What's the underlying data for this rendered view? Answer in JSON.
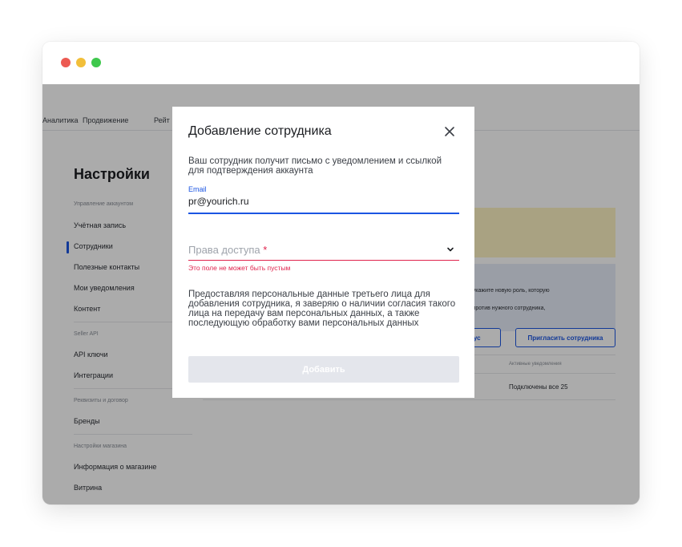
{
  "window": {
    "controls": [
      "close",
      "minimize",
      "maximize"
    ]
  },
  "topnav": {
    "items": [
      "Аналитика",
      "Продвижение",
      "Рейт"
    ]
  },
  "sidebar": {
    "title": "Настройки",
    "groups": [
      {
        "label": "Управление аккаунтом",
        "items": [
          "Учётная запись",
          "Сотрудники",
          "Полезные контакты",
          "Мои уведомления",
          "Контент"
        ]
      },
      {
        "label": "Seller API",
        "items": [
          "API ключи",
          "Интеграции"
        ]
      },
      {
        "label": "Реквизиты и договор",
        "items": [
          "Бренды"
        ]
      },
      {
        "label": "Настройки магазина",
        "items": [
          "Информация о магазине",
          "Витрина"
        ]
      }
    ],
    "active_item": "Сотрудники"
  },
  "main": {
    "info_line_1": "тем укажите новую роль, которую",
    "info_line_2": "е напротив нужного сотрудника,",
    "status_button": "татус",
    "invite_button": "Пригласить сотрудника",
    "table": {
      "column_header": "Активные уведомления",
      "cell": "Подключены все 25"
    }
  },
  "modal": {
    "title": "Добавление сотрудника",
    "description": "Ваш сотрудник получит письмо с уведомлением и ссылкой для подтверждения аккаунта",
    "email_label": "Email",
    "email_value": "pr@yourich.ru",
    "access_placeholder": "Права доступа",
    "required_mark": "*",
    "error": "Это поле не может быть пустым",
    "consent": "Предоставляя персональные данные третьего лица для добавления сотрудника, я заверяю о наличии согласия такого лица на передачу вам персональных данных, а также последующую обработку вами персональных данных",
    "submit": "Добавить"
  },
  "colors": {
    "accent": "#1b55e2",
    "error": "#e0244d",
    "disabled_button": "#e4e6ec",
    "yellow_banner": "#fdf2c2",
    "blue_banner": "#e6ecf8"
  }
}
